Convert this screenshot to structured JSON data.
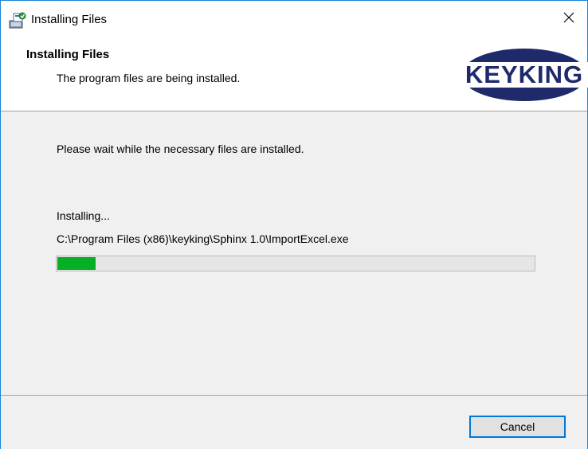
{
  "window": {
    "title": "Installing Files",
    "title_icon": "installer-icon",
    "close_icon": "close-icon"
  },
  "header": {
    "title": "Installing Files",
    "subtitle": "The program files are being installed.",
    "logo_text": "KEYKING"
  },
  "main": {
    "message": "Please wait while the necessary files are installed.",
    "status": "Installing...",
    "current_file": "C:\\Program Files (x86)\\keyking\\Sphinx 1.0\\ImportExcel.exe",
    "progress_fraction": 0.08
  },
  "footer": {
    "cancel_label": "Cancel"
  },
  "colors": {
    "progress_fill": "#06b025",
    "logo_navy": "#1f2a6b",
    "focus_border": "#0078d7"
  }
}
